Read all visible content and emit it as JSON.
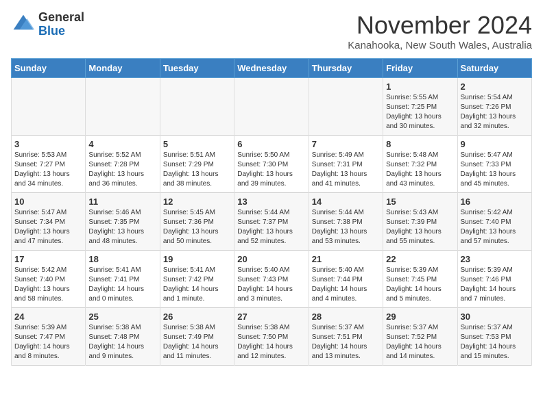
{
  "logo": {
    "text_general": "General",
    "text_blue": "Blue"
  },
  "header": {
    "month_title": "November 2024",
    "location": "Kanahooka, New South Wales, Australia"
  },
  "weekdays": [
    "Sunday",
    "Monday",
    "Tuesday",
    "Wednesday",
    "Thursday",
    "Friday",
    "Saturday"
  ],
  "weeks": [
    [
      {
        "day": "",
        "info": ""
      },
      {
        "day": "",
        "info": ""
      },
      {
        "day": "",
        "info": ""
      },
      {
        "day": "",
        "info": ""
      },
      {
        "day": "",
        "info": ""
      },
      {
        "day": "1",
        "info": "Sunrise: 5:55 AM\nSunset: 7:25 PM\nDaylight: 13 hours and 30 minutes."
      },
      {
        "day": "2",
        "info": "Sunrise: 5:54 AM\nSunset: 7:26 PM\nDaylight: 13 hours and 32 minutes."
      }
    ],
    [
      {
        "day": "3",
        "info": "Sunrise: 5:53 AM\nSunset: 7:27 PM\nDaylight: 13 hours and 34 minutes."
      },
      {
        "day": "4",
        "info": "Sunrise: 5:52 AM\nSunset: 7:28 PM\nDaylight: 13 hours and 36 minutes."
      },
      {
        "day": "5",
        "info": "Sunrise: 5:51 AM\nSunset: 7:29 PM\nDaylight: 13 hours and 38 minutes."
      },
      {
        "day": "6",
        "info": "Sunrise: 5:50 AM\nSunset: 7:30 PM\nDaylight: 13 hours and 39 minutes."
      },
      {
        "day": "7",
        "info": "Sunrise: 5:49 AM\nSunset: 7:31 PM\nDaylight: 13 hours and 41 minutes."
      },
      {
        "day": "8",
        "info": "Sunrise: 5:48 AM\nSunset: 7:32 PM\nDaylight: 13 hours and 43 minutes."
      },
      {
        "day": "9",
        "info": "Sunrise: 5:47 AM\nSunset: 7:33 PM\nDaylight: 13 hours and 45 minutes."
      }
    ],
    [
      {
        "day": "10",
        "info": "Sunrise: 5:47 AM\nSunset: 7:34 PM\nDaylight: 13 hours and 47 minutes."
      },
      {
        "day": "11",
        "info": "Sunrise: 5:46 AM\nSunset: 7:35 PM\nDaylight: 13 hours and 48 minutes."
      },
      {
        "day": "12",
        "info": "Sunrise: 5:45 AM\nSunset: 7:36 PM\nDaylight: 13 hours and 50 minutes."
      },
      {
        "day": "13",
        "info": "Sunrise: 5:44 AM\nSunset: 7:37 PM\nDaylight: 13 hours and 52 minutes."
      },
      {
        "day": "14",
        "info": "Sunrise: 5:44 AM\nSunset: 7:38 PM\nDaylight: 13 hours and 53 minutes."
      },
      {
        "day": "15",
        "info": "Sunrise: 5:43 AM\nSunset: 7:39 PM\nDaylight: 13 hours and 55 minutes."
      },
      {
        "day": "16",
        "info": "Sunrise: 5:42 AM\nSunset: 7:40 PM\nDaylight: 13 hours and 57 minutes."
      }
    ],
    [
      {
        "day": "17",
        "info": "Sunrise: 5:42 AM\nSunset: 7:40 PM\nDaylight: 13 hours and 58 minutes."
      },
      {
        "day": "18",
        "info": "Sunrise: 5:41 AM\nSunset: 7:41 PM\nDaylight: 14 hours and 0 minutes."
      },
      {
        "day": "19",
        "info": "Sunrise: 5:41 AM\nSunset: 7:42 PM\nDaylight: 14 hours and 1 minute."
      },
      {
        "day": "20",
        "info": "Sunrise: 5:40 AM\nSunset: 7:43 PM\nDaylight: 14 hours and 3 minutes."
      },
      {
        "day": "21",
        "info": "Sunrise: 5:40 AM\nSunset: 7:44 PM\nDaylight: 14 hours and 4 minutes."
      },
      {
        "day": "22",
        "info": "Sunrise: 5:39 AM\nSunset: 7:45 PM\nDaylight: 14 hours and 5 minutes."
      },
      {
        "day": "23",
        "info": "Sunrise: 5:39 AM\nSunset: 7:46 PM\nDaylight: 14 hours and 7 minutes."
      }
    ],
    [
      {
        "day": "24",
        "info": "Sunrise: 5:39 AM\nSunset: 7:47 PM\nDaylight: 14 hours and 8 minutes."
      },
      {
        "day": "25",
        "info": "Sunrise: 5:38 AM\nSunset: 7:48 PM\nDaylight: 14 hours and 9 minutes."
      },
      {
        "day": "26",
        "info": "Sunrise: 5:38 AM\nSunset: 7:49 PM\nDaylight: 14 hours and 11 minutes."
      },
      {
        "day": "27",
        "info": "Sunrise: 5:38 AM\nSunset: 7:50 PM\nDaylight: 14 hours and 12 minutes."
      },
      {
        "day": "28",
        "info": "Sunrise: 5:37 AM\nSunset: 7:51 PM\nDaylight: 14 hours and 13 minutes."
      },
      {
        "day": "29",
        "info": "Sunrise: 5:37 AM\nSunset: 7:52 PM\nDaylight: 14 hours and 14 minutes."
      },
      {
        "day": "30",
        "info": "Sunrise: 5:37 AM\nSunset: 7:53 PM\nDaylight: 14 hours and 15 minutes."
      }
    ]
  ]
}
